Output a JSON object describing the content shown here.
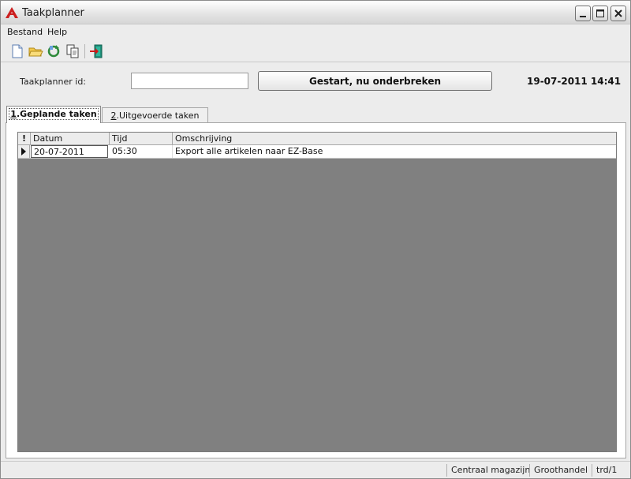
{
  "window": {
    "title": "Taakplanner"
  },
  "menu": {
    "items": [
      "Bestand",
      "Help"
    ]
  },
  "toolbar": {
    "icons": [
      "new-document-icon",
      "open-folder-icon",
      "refresh-icon",
      "copy-icon",
      "exit-icon"
    ]
  },
  "header": {
    "id_label": "Taakplanner id:",
    "id_value": "",
    "action_button": "Gestart, nu onderbreken",
    "datetime": "19-07-2011 14:41"
  },
  "tabs": [
    {
      "key": "1",
      "label": ".Geplande taken",
      "active": true
    },
    {
      "key": "2",
      "label": ".Uitgevoerde taken",
      "active": false
    }
  ],
  "grid": {
    "columns": [
      "!",
      "Datum",
      "Tijd",
      "Omschrijving"
    ],
    "rows": [
      {
        "datum": "20-07-2011",
        "tijd": "05:30",
        "omschrijving": "Export alle artikelen naar EZ-Base"
      }
    ]
  },
  "status": {
    "location": "Centraal magazijn",
    "type": "Groothandel",
    "session": "trd/1"
  },
  "colors": {
    "grid_background": "#808080",
    "app_icon": "#cc1f1f"
  }
}
